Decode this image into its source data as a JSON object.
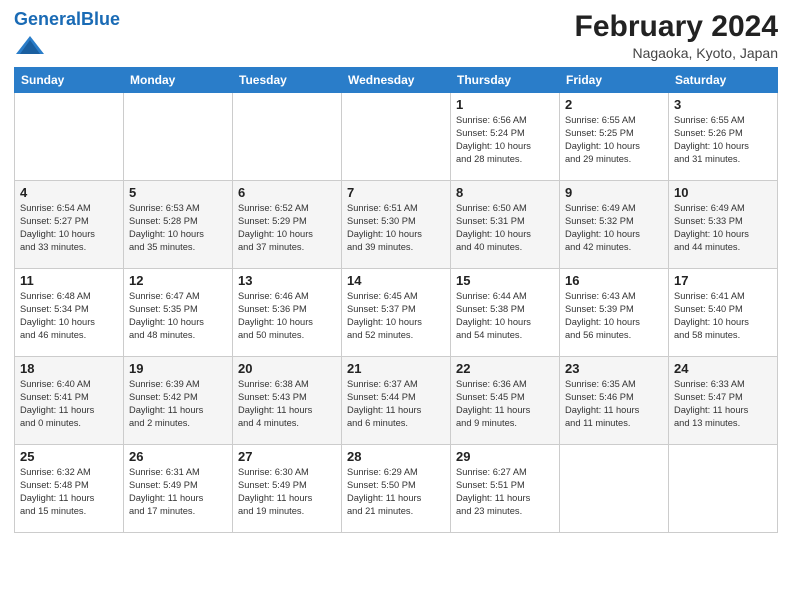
{
  "header": {
    "logo_general": "General",
    "logo_blue": "Blue",
    "title": "February 2024",
    "subtitle": "Nagaoka, Kyoto, Japan"
  },
  "days_of_week": [
    "Sunday",
    "Monday",
    "Tuesday",
    "Wednesday",
    "Thursday",
    "Friday",
    "Saturday"
  ],
  "weeks": [
    [
      {
        "day": "",
        "info": ""
      },
      {
        "day": "",
        "info": ""
      },
      {
        "day": "",
        "info": ""
      },
      {
        "day": "",
        "info": ""
      },
      {
        "day": "1",
        "info": "Sunrise: 6:56 AM\nSunset: 5:24 PM\nDaylight: 10 hours\nand 28 minutes."
      },
      {
        "day": "2",
        "info": "Sunrise: 6:55 AM\nSunset: 5:25 PM\nDaylight: 10 hours\nand 29 minutes."
      },
      {
        "day": "3",
        "info": "Sunrise: 6:55 AM\nSunset: 5:26 PM\nDaylight: 10 hours\nand 31 minutes."
      }
    ],
    [
      {
        "day": "4",
        "info": "Sunrise: 6:54 AM\nSunset: 5:27 PM\nDaylight: 10 hours\nand 33 minutes."
      },
      {
        "day": "5",
        "info": "Sunrise: 6:53 AM\nSunset: 5:28 PM\nDaylight: 10 hours\nand 35 minutes."
      },
      {
        "day": "6",
        "info": "Sunrise: 6:52 AM\nSunset: 5:29 PM\nDaylight: 10 hours\nand 37 minutes."
      },
      {
        "day": "7",
        "info": "Sunrise: 6:51 AM\nSunset: 5:30 PM\nDaylight: 10 hours\nand 39 minutes."
      },
      {
        "day": "8",
        "info": "Sunrise: 6:50 AM\nSunset: 5:31 PM\nDaylight: 10 hours\nand 40 minutes."
      },
      {
        "day": "9",
        "info": "Sunrise: 6:49 AM\nSunset: 5:32 PM\nDaylight: 10 hours\nand 42 minutes."
      },
      {
        "day": "10",
        "info": "Sunrise: 6:49 AM\nSunset: 5:33 PM\nDaylight: 10 hours\nand 44 minutes."
      }
    ],
    [
      {
        "day": "11",
        "info": "Sunrise: 6:48 AM\nSunset: 5:34 PM\nDaylight: 10 hours\nand 46 minutes."
      },
      {
        "day": "12",
        "info": "Sunrise: 6:47 AM\nSunset: 5:35 PM\nDaylight: 10 hours\nand 48 minutes."
      },
      {
        "day": "13",
        "info": "Sunrise: 6:46 AM\nSunset: 5:36 PM\nDaylight: 10 hours\nand 50 minutes."
      },
      {
        "day": "14",
        "info": "Sunrise: 6:45 AM\nSunset: 5:37 PM\nDaylight: 10 hours\nand 52 minutes."
      },
      {
        "day": "15",
        "info": "Sunrise: 6:44 AM\nSunset: 5:38 PM\nDaylight: 10 hours\nand 54 minutes."
      },
      {
        "day": "16",
        "info": "Sunrise: 6:43 AM\nSunset: 5:39 PM\nDaylight: 10 hours\nand 56 minutes."
      },
      {
        "day": "17",
        "info": "Sunrise: 6:41 AM\nSunset: 5:40 PM\nDaylight: 10 hours\nand 58 minutes."
      }
    ],
    [
      {
        "day": "18",
        "info": "Sunrise: 6:40 AM\nSunset: 5:41 PM\nDaylight: 11 hours\nand 0 minutes."
      },
      {
        "day": "19",
        "info": "Sunrise: 6:39 AM\nSunset: 5:42 PM\nDaylight: 11 hours\nand 2 minutes."
      },
      {
        "day": "20",
        "info": "Sunrise: 6:38 AM\nSunset: 5:43 PM\nDaylight: 11 hours\nand 4 minutes."
      },
      {
        "day": "21",
        "info": "Sunrise: 6:37 AM\nSunset: 5:44 PM\nDaylight: 11 hours\nand 6 minutes."
      },
      {
        "day": "22",
        "info": "Sunrise: 6:36 AM\nSunset: 5:45 PM\nDaylight: 11 hours\nand 9 minutes."
      },
      {
        "day": "23",
        "info": "Sunrise: 6:35 AM\nSunset: 5:46 PM\nDaylight: 11 hours\nand 11 minutes."
      },
      {
        "day": "24",
        "info": "Sunrise: 6:33 AM\nSunset: 5:47 PM\nDaylight: 11 hours\nand 13 minutes."
      }
    ],
    [
      {
        "day": "25",
        "info": "Sunrise: 6:32 AM\nSunset: 5:48 PM\nDaylight: 11 hours\nand 15 minutes."
      },
      {
        "day": "26",
        "info": "Sunrise: 6:31 AM\nSunset: 5:49 PM\nDaylight: 11 hours\nand 17 minutes."
      },
      {
        "day": "27",
        "info": "Sunrise: 6:30 AM\nSunset: 5:49 PM\nDaylight: 11 hours\nand 19 minutes."
      },
      {
        "day": "28",
        "info": "Sunrise: 6:29 AM\nSunset: 5:50 PM\nDaylight: 11 hours\nand 21 minutes."
      },
      {
        "day": "29",
        "info": "Sunrise: 6:27 AM\nSunset: 5:51 PM\nDaylight: 11 hours\nand 23 minutes."
      },
      {
        "day": "",
        "info": ""
      },
      {
        "day": "",
        "info": ""
      }
    ]
  ]
}
